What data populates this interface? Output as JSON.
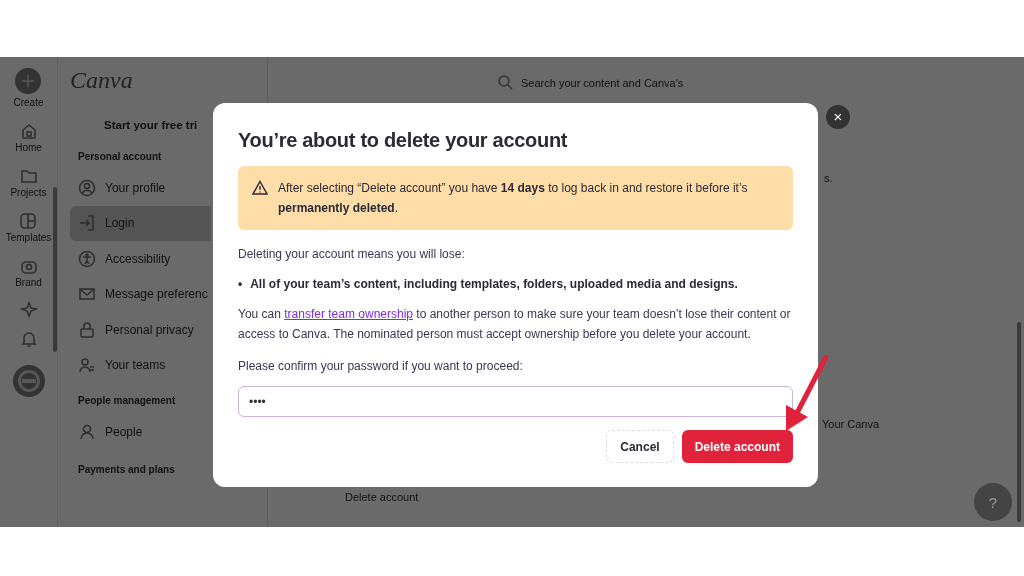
{
  "app": {
    "logo": "Canva",
    "rail": [
      {
        "kind": "create",
        "label": "Create"
      },
      {
        "kind": "home",
        "label": "Home"
      },
      {
        "kind": "projects",
        "label": "Projects"
      },
      {
        "kind": "templates",
        "label": "Templates"
      },
      {
        "kind": "brand",
        "label": "Brand"
      },
      {
        "kind": "magic"
      },
      {
        "kind": "bell"
      },
      {
        "kind": "avatar"
      }
    ],
    "search": {
      "placeholder": "Search your content and Canva's"
    },
    "sidebar": {
      "promo": "Start your free tri",
      "sections": [
        {
          "heading": "Personal account",
          "items": [
            {
              "kind": "profile",
              "label": "Your profile",
              "selected": false
            },
            {
              "kind": "login",
              "label": "Login",
              "selected": true
            },
            {
              "kind": "accessibility",
              "label": "Accessibility",
              "selected": false
            },
            {
              "kind": "message",
              "label": "Message preferenc",
              "selected": false
            },
            {
              "kind": "privacy",
              "label": "Personal privacy",
              "selected": false
            },
            {
              "kind": "teams",
              "label": "Your teams",
              "selected": false
            }
          ]
        },
        {
          "heading": "People management",
          "items": [
            {
              "kind": "people",
              "label": "People",
              "selected": false
            }
          ]
        },
        {
          "heading": "Payments and plans"
        }
      ]
    },
    "main": {
      "fragment": "s.",
      "side_text": "Your Canva",
      "delete_link": "Delete account",
      "help": "?"
    }
  },
  "dialog": {
    "title": "You’re about to delete your account",
    "notice": "After selecting “Delete account” you have **14 days** to log back in and restore it before it’s **permanently deleted**.",
    "intro": "Deleting your account means you will lose:",
    "bullets": [
      {
        "marker": "•",
        "text": "All of your team’s content, including templates, folders, uploaded media and designs."
      }
    ],
    "transfer": {
      "before": "You can ",
      "link": "transfer team ownership",
      "after": " to another person to make sure your team doesn’t lose their content or access to Canva. The nominated person must accept ownership before you delete your account."
    },
    "confirm_label": "Please confirm your password if you want to proceed:",
    "password": {
      "value": "••••"
    },
    "buttons": [
      {
        "kind": "secondary",
        "label": "Cancel"
      },
      {
        "kind": "danger",
        "label": "Delete account"
      }
    ],
    "close": "×"
  }
}
